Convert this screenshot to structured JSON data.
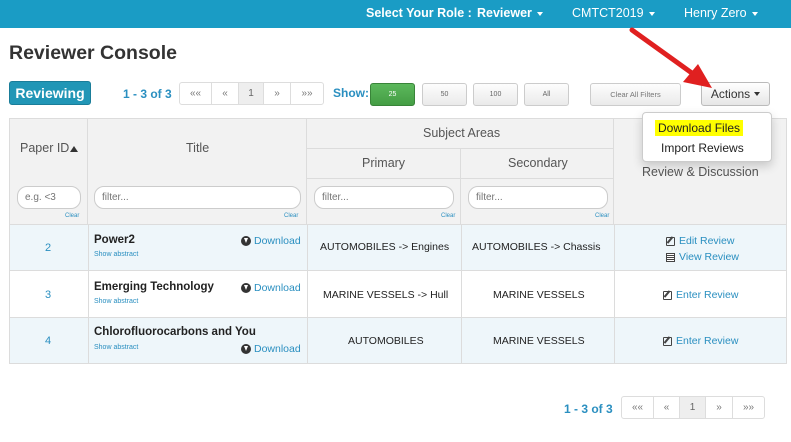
{
  "topnav": {
    "role_label": "Select Your Role :",
    "role_value": "Reviewer",
    "conference": "CMTCT2019",
    "user": "Henry Zero"
  },
  "page": {
    "title": "Reviewer Console",
    "mode_button": "Reviewing"
  },
  "pagination": {
    "count_label": "1 - 3 of 3",
    "first": "««",
    "prev": "«",
    "current": "1",
    "next": "»",
    "last": "»»"
  },
  "page_size": {
    "label": "Show:",
    "options": [
      "25",
      "50",
      "100",
      "All"
    ],
    "selected": "25"
  },
  "toolbar": {
    "clear_filters": "Clear All Filters",
    "actions": "Actions"
  },
  "actions_menu": {
    "items": [
      "Download Files",
      "Import Reviews"
    ]
  },
  "table": {
    "headers": {
      "paper_id": "Paper ID",
      "title": "Title",
      "subject_areas": "Subject Areas",
      "primary": "Primary",
      "secondary": "Secondary",
      "review_discussion": "Review & Discussion"
    },
    "filters": {
      "paper_id_placeholder": "e.g. <3",
      "title_placeholder": "filter...",
      "primary_placeholder": "filter...",
      "secondary_placeholder": "filter...",
      "clear": "Clear"
    },
    "rows": [
      {
        "id": "2",
        "title": "Power2",
        "show_abstract": "Show abstract",
        "download": "Download",
        "primary": "AUTOMOBILES -> Engines",
        "secondary": "AUTOMOBILES -> Chassis",
        "actions": [
          "Edit Review",
          "View Review"
        ]
      },
      {
        "id": "3",
        "title": "Emerging Technology",
        "show_abstract": "Show abstract",
        "download": "Download",
        "primary": "MARINE VESSELS -> Hull",
        "secondary": "MARINE VESSELS",
        "actions": [
          "Enter Review"
        ]
      },
      {
        "id": "4",
        "title": "Chlorofluorocarbons and You",
        "show_abstract": "Show abstract",
        "download": "Download",
        "primary": "AUTOMOBILES",
        "secondary": "MARINE VESSELS",
        "actions": [
          "Enter Review"
        ]
      }
    ]
  },
  "colors": {
    "nav": "#1a9cc5",
    "accent": "#2a8fc0",
    "selected_size": "#5cb85c",
    "highlight": "#ffff00",
    "annotation_arrow": "#e02020"
  },
  "icons": [
    "caret-down-icon",
    "sort-up-icon",
    "download-icon",
    "edit-icon",
    "list-icon",
    "red-arrow-annotation"
  ]
}
